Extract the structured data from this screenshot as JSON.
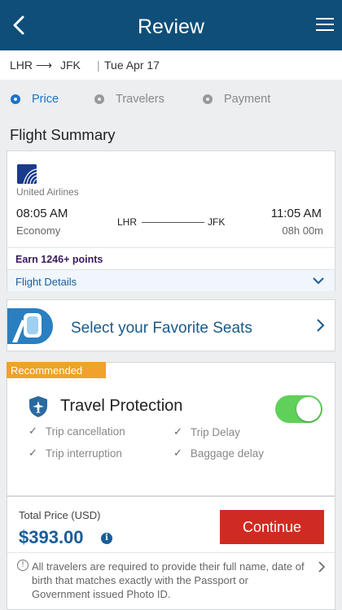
{
  "header": {
    "title": "Review"
  },
  "route": {
    "from": "LHR",
    "to": "JFK",
    "arrow": "⟶",
    "separator": "|",
    "date": "Tue Apr 17"
  },
  "steps": [
    {
      "label": "Price",
      "active": true
    },
    {
      "label": "Travelers",
      "active": false
    },
    {
      "label": "Payment",
      "active": false
    }
  ],
  "section_title": "Flight Summary",
  "flight": {
    "airline": "United Airlines",
    "departure_time": "08:05 AM",
    "arrival_time": "11:05 AM",
    "cabin": "Economy",
    "duration": "08h 00m",
    "origin": "LHR",
    "destination": "JFK",
    "earn_points": "Earn 1246+ points",
    "details_label": "Flight Details"
  },
  "seats": {
    "label": "Select your Favorite Seats"
  },
  "protection": {
    "badge": "Recommended",
    "title": "Travel Protection",
    "enabled": true,
    "benefits": [
      "Trip cancellation",
      "Trip Delay",
      "Trip interruption",
      "Baggage delay"
    ]
  },
  "total": {
    "label": "Total Price (USD)",
    "price": "$393.00",
    "continue_label": "Continue"
  },
  "notice": "All travelers are required to provide their full name, date of birth that matches exactly with the Passport or Government issued Photo ID.",
  "colors": {
    "header": "#0f4e78",
    "accent": "#1a73c8",
    "continue": "#d02b22",
    "badge": "#f2a12a",
    "toggle": "#5fd15a"
  }
}
